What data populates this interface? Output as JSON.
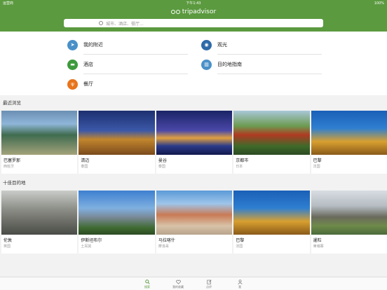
{
  "status": {
    "carrier": "运营商",
    "time": "下午1:43",
    "battery": "100%"
  },
  "header": {
    "logo_text": "tripadvisor",
    "search_placeholder": "城市、酒店、餐厅..."
  },
  "quick": [
    {
      "label": "我的附近",
      "color": "#4a90c8",
      "icon": "near-me-icon",
      "glyph": "➤"
    },
    {
      "label": "观光",
      "color": "#2f6aa8",
      "icon": "binoculars-icon",
      "glyph": "◉"
    },
    {
      "label": "酒店",
      "color": "#3d9a3c",
      "icon": "hotel-bed-icon",
      "glyph": "▬"
    },
    {
      "label": "目的地指南",
      "color": "#4a90c8",
      "icon": "city-guide-icon",
      "glyph": "▥"
    },
    {
      "label": "餐厅",
      "color": "#e8741b",
      "icon": "restaurant-icon",
      "glyph": "ψ"
    }
  ],
  "recent": {
    "title": "最近浏览",
    "items": [
      {
        "name": "巴塞罗那",
        "country": "西班牙"
      },
      {
        "name": "清迈",
        "country": "泰国"
      },
      {
        "name": "曼谷",
        "country": "泰国"
      },
      {
        "name": "京都市",
        "country": "日本"
      },
      {
        "name": "巴黎",
        "country": "法国"
      }
    ]
  },
  "top": {
    "title": "十佳目的地",
    "items": [
      {
        "name": "伦敦",
        "country": "英国"
      },
      {
        "name": "伊斯坦布尔",
        "country": "土耳其"
      },
      {
        "name": "马拉喀什",
        "country": "摩洛哥"
      },
      {
        "name": "巴黎",
        "country": "法国"
      },
      {
        "name": "暹粒",
        "country": "柬埔寨"
      }
    ]
  },
  "tabs": [
    {
      "label": "搜索",
      "icon": "search-icon"
    },
    {
      "label": "我的收藏",
      "icon": "heart-icon"
    },
    {
      "label": "点评",
      "icon": "edit-icon"
    },
    {
      "label": "我",
      "icon": "profile-icon"
    }
  ]
}
